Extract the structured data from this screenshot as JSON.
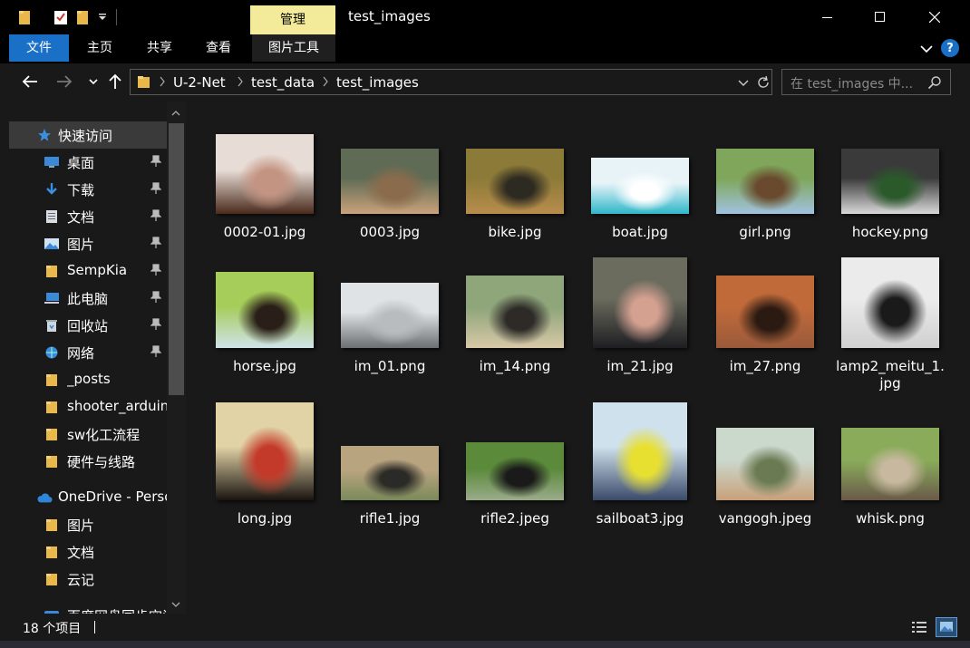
{
  "titlebar": {
    "manage_tab": "管理",
    "title": "test_images"
  },
  "ribbon": {
    "tabs": [
      "文件",
      "主页",
      "共享",
      "查看",
      "图片工具"
    ],
    "help": "?"
  },
  "address": {
    "crumbs": [
      "U-2-Net",
      "test_data",
      "test_images"
    ],
    "search_placeholder": "在 test_images 中..."
  },
  "sidebar": {
    "quick_access": "快速访问",
    "items": [
      {
        "label": "桌面",
        "icon": "desktop-icon",
        "pinned": true
      },
      {
        "label": "下载",
        "icon": "download-icon",
        "pinned": true
      },
      {
        "label": "文档",
        "icon": "documents-icon",
        "pinned": true
      },
      {
        "label": "图片",
        "icon": "pictures-icon",
        "pinned": true
      },
      {
        "label": "SempKia",
        "icon": "folder-icon",
        "pinned": true
      },
      {
        "label": "此电脑",
        "icon": "computer-icon",
        "pinned": true
      },
      {
        "label": "回收站",
        "icon": "recycle-bin-icon",
        "pinned": true
      },
      {
        "label": "网络",
        "icon": "network-icon",
        "pinned": true
      },
      {
        "label": "_posts",
        "icon": "folder-icon",
        "pinned": false
      },
      {
        "label": "shooter_arduino",
        "icon": "folder-icon",
        "pinned": false
      },
      {
        "label": "sw化工流程",
        "icon": "folder-icon",
        "pinned": false
      },
      {
        "label": "硬件与线路",
        "icon": "folder-icon",
        "pinned": false
      }
    ],
    "onedrive": "OneDrive - Personal",
    "onedrive_items": [
      "图片",
      "文档",
      "云记"
    ],
    "cut_item": "百度网盘同步空间"
  },
  "files": [
    {
      "name": "0002-01.jpg",
      "colors": [
        "#e8ddd6",
        "#4a2a1c",
        "#c49482"
      ]
    },
    {
      "name": "0003.jpg",
      "colors": [
        "#5f6b55",
        "#c9a27b",
        "#8a6b4b"
      ]
    },
    {
      "name": "bike.jpg",
      "colors": [
        "#8c7a38",
        "#b88d4c",
        "#2d2a22"
      ]
    },
    {
      "name": "boat.jpg",
      "colors": [
        "#e8f3f8",
        "#2fb7c9",
        "#ffffff"
      ]
    },
    {
      "name": "girl.png",
      "colors": [
        "#7fa65a",
        "#a0c2e0",
        "#6a4a2e"
      ]
    },
    {
      "name": "hockey.png",
      "colors": [
        "#3a3a3a",
        "#d8d8d8",
        "#2a5a2a"
      ]
    },
    {
      "name": "horse.jpg",
      "colors": [
        "#a6cc5a",
        "#cfe3e8",
        "#2a1e18"
      ]
    },
    {
      "name": "im_01.png",
      "colors": [
        "#dfe3e6",
        "#6c6f72",
        "#b8bcbf"
      ]
    },
    {
      "name": "im_14.png",
      "colors": [
        "#8fa67a",
        "#d8c8a8",
        "#2e2a28"
      ]
    },
    {
      "name": "im_21.jpg",
      "colors": [
        "#6b6b5e",
        "#1e1e22",
        "#d4a090"
      ]
    },
    {
      "name": "im_27.png",
      "colors": [
        "#c06a3a",
        "#9a5a3a",
        "#2a1a12"
      ]
    },
    {
      "name": "lamp2_meitu_1.jpg",
      "colors": [
        "#ebebeb",
        "#d0d0d0",
        "#1a1a1a"
      ]
    },
    {
      "name": "long.jpg",
      "colors": [
        "#e2d3a6",
        "#1a1410",
        "#c43a2a"
      ]
    },
    {
      "name": "rifle1.jpg",
      "colors": [
        "#b9a480",
        "#7a8a5a",
        "#2a2a26"
      ]
    },
    {
      "name": "rifle2.jpeg",
      "colors": [
        "#5a8a3a",
        "#9aab8a",
        "#1a1a1a"
      ]
    },
    {
      "name": "sailboat3.jpg",
      "colors": [
        "#cfe1ec",
        "#3a4a6a",
        "#e8e030"
      ]
    },
    {
      "name": "vangogh.jpeg",
      "colors": [
        "#cbd8cc",
        "#c8a07a",
        "#6a7a52"
      ]
    },
    {
      "name": "whisk.png",
      "colors": [
        "#8aab5a",
        "#6a5a4a",
        "#c8b8a0"
      ]
    }
  ],
  "status": {
    "count_text": "18 个项目"
  }
}
